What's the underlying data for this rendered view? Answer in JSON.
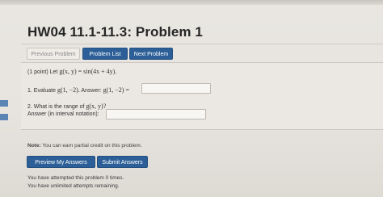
{
  "page": {
    "title": "HW04 11.1-11.3: Problem 1"
  },
  "nav": {
    "previous_label": "Previous Problem",
    "list_label": "Problem List",
    "next_label": "Next Problem"
  },
  "problem": {
    "intro_prefix": "(1 point) Let ",
    "intro_math": "g(x, y) = sin(4x + 4y).",
    "q1_prefix": "1. Evaluate ",
    "q1_math": "g(1, −2).",
    "q1_answer_prefix": " Answer: ",
    "q1_answer_math": "g(1, −2) =",
    "q1_value": "",
    "q2_prefix": "2. What is the range of ",
    "q2_math": "g(x, y)?",
    "q2_answer_label": "Answer (in interval notation):",
    "q2_value": ""
  },
  "note": {
    "bold": "Note:",
    "text": " You can earn partial credit on this problem."
  },
  "actions": {
    "preview_label": "Preview My Answers",
    "submit_label": "Submit Answers"
  },
  "status": {
    "attempts": "You have attempted this problem 0 times.",
    "remaining": "You have unlimited attempts remaining."
  },
  "colors": {
    "primary_button": "#2c5f97",
    "background": "#e9e6e1"
  }
}
